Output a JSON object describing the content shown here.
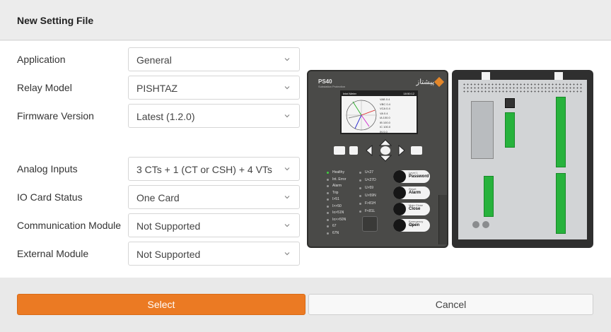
{
  "dialog": {
    "title": "New Setting File"
  },
  "form": {
    "fields": [
      {
        "label": "Application",
        "value": "General"
      },
      {
        "label": "Relay Model",
        "value": "PISHTAZ"
      },
      {
        "label": "Firmware Version",
        "value": "Latest (1.2.0)"
      },
      {
        "label": "Analog Inputs",
        "value": "3 CTs + 1 (CT or CSH) + 4 VTs"
      },
      {
        "label": "IO Card Status",
        "value": "One Card"
      },
      {
        "label": "Communication Module",
        "value": "Not Supported"
      },
      {
        "label": "External Module",
        "value": "Not Supported"
      }
    ]
  },
  "buttons": {
    "select": "Select",
    "cancel": "Cancel"
  },
  "device": {
    "front": {
      "model": "PS40",
      "subtitle": "Substation Protection",
      "brand": "پیشتاز",
      "lcd": {
        "menu": "Intel Meter",
        "time": "18:50:12",
        "rows": [
          "VAB 0.4",
          "VBC 0.4",
          "VCA 0.4",
          "VA 0.4",
          "IA 100.0",
          "IB 100.0",
          "IC 100.0",
          "IN 0.0"
        ]
      },
      "leds_left": [
        "Healthy",
        "Int. Error",
        "Alarm",
        "Trip",
        "I>51",
        "I>>50",
        "Io>51N",
        "Io>>50N",
        "67",
        "67N"
      ],
      "leds_right": [
        "U<27",
        "U<27D",
        "U>59",
        "U>59N",
        "F>81H",
        "F<81L"
      ],
      "function_keys": [
        {
          "title": "Level 1",
          "main": "Password"
        },
        {
          "title": "Reset",
          "main": "Alarm"
        },
        {
          "title": "Main Close",
          "main": "Close"
        },
        {
          "title": "Emergency Open",
          "main": "Open"
        }
      ]
    },
    "colors": {
      "accent": "#eb7a23",
      "terminal": "#27b23c"
    }
  }
}
